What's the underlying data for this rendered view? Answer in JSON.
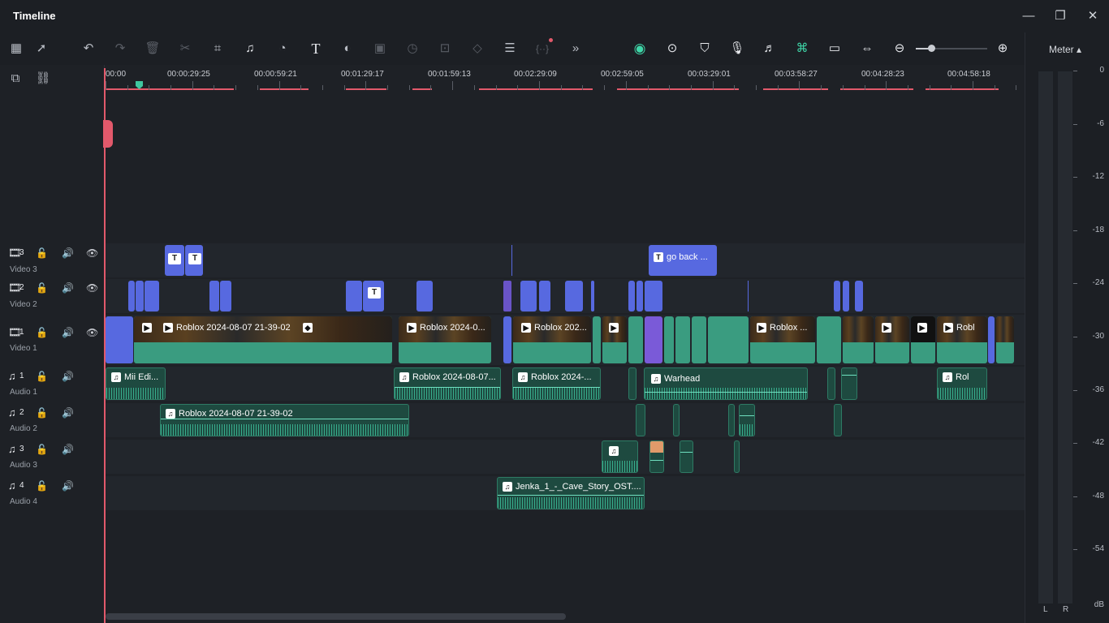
{
  "window": {
    "title": "Timeline",
    "minimize": "—",
    "maximize": "❐",
    "close": "✕"
  },
  "toolbar": {
    "icons": [
      "layout-icon",
      "select-tool-icon",
      "undo-icon",
      "redo-icon",
      "delete-icon",
      "cut-icon",
      "crop-icon",
      "audio-edit-icon",
      "speed-icon",
      "text-icon",
      "color-icon",
      "mask-icon",
      "duration-icon",
      "stabilize-icon",
      "keyframe-icon",
      "adjust-icon",
      "split-icon",
      "more-icon",
      "ai-icon",
      "play-range-icon",
      "marker-icon",
      "mic-icon",
      "audio-mix-icon",
      "snap-icon",
      "preview-icon",
      "fit-icon",
      "zoom-out-icon",
      "zoom-in-icon"
    ]
  },
  "ruler": {
    "labels": [
      "00:00",
      "00:00:29:25",
      "00:00:59:21",
      "00:01:29:17",
      "00:01:59:13",
      "00:02:29:09",
      "00:02:59:05",
      "00:03:29:01",
      "00:03:58:27",
      "00:04:28:23",
      "00:04:58:18"
    ]
  },
  "tracks": [
    {
      "num": "3",
      "name": "Video 3",
      "kind": "video"
    },
    {
      "num": "2",
      "name": "Video 2",
      "kind": "video"
    },
    {
      "num": "1",
      "name": "Video 1",
      "kind": "video"
    },
    {
      "num": "1",
      "name": "Audio 1",
      "kind": "audio"
    },
    {
      "num": "2",
      "name": "Audio 2",
      "kind": "audio"
    },
    {
      "num": "3",
      "name": "Audio 3",
      "kind": "audio"
    },
    {
      "num": "4",
      "name": "Audio 4",
      "kind": "audio"
    }
  ],
  "clips": {
    "v3_title_go_back": "go back ...",
    "v1_a": "Roblox 2024-08-07 21-39-02",
    "v1_b": "Roblox 2024-0...",
    "v1_c": "Roblox 202...",
    "v1_d": "Roblox ...",
    "v1_e": "Robl",
    "a1_a": "Mii Edi...",
    "a1_b": "Roblox 2024-08-07...",
    "a1_c": "Roblox 2024-...",
    "a1_d": "Warhead",
    "a1_e": "Rol",
    "a2_a": "Roblox 2024-08-07 21-39-02",
    "a4_a": "Jenka_1_-_Cave_Story_OST...."
  },
  "meter": {
    "title": "Meter ▴",
    "scale": [
      "0",
      "-6",
      "-12",
      "-18",
      "-24",
      "-30",
      "-36",
      "-42",
      "-48",
      "-54",
      "dB"
    ],
    "left": "L",
    "right": "R"
  },
  "colors": {
    "accent_green": "#3fc7a0",
    "title_clip": "#5769e0",
    "playhead": "#e2596b"
  }
}
